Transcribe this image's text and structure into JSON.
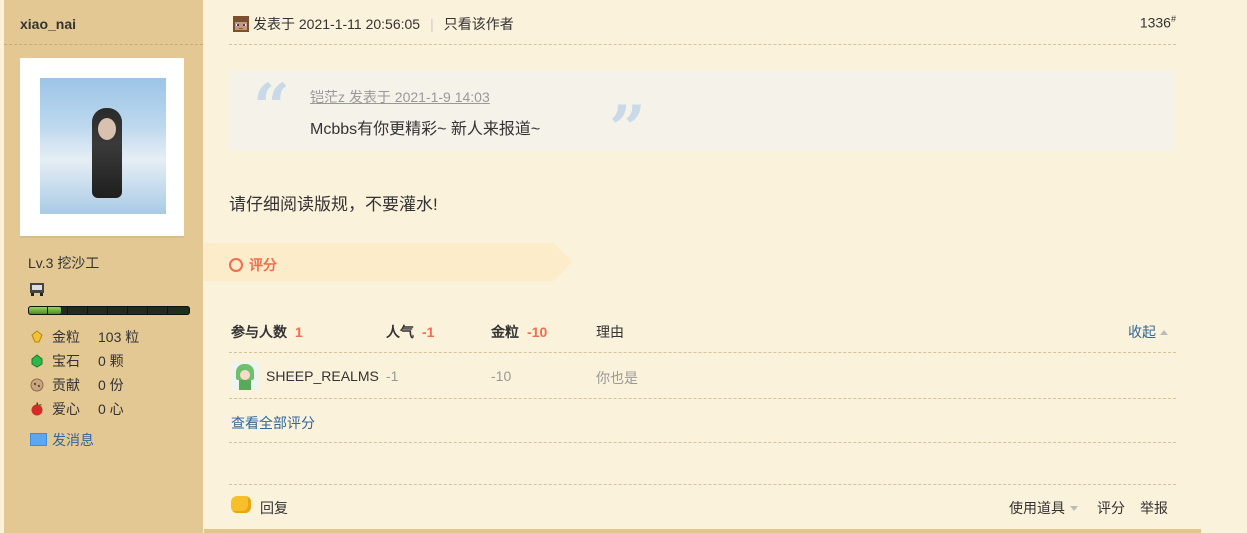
{
  "user": {
    "name": "xiao_nai",
    "level": "Lv.3 挖沙工",
    "level_progress": 0.2,
    "stats": [
      {
        "icon": "gold-nugget-icon",
        "label": "金粒",
        "value": "103 粒",
        "color": "#e8b21c"
      },
      {
        "icon": "emerald-icon",
        "label": "宝石",
        "value": "0 颗",
        "color": "#2fb84a"
      },
      {
        "icon": "contribution-icon",
        "label": "贡献",
        "value": "0 份",
        "color": "#a08060"
      },
      {
        "icon": "apple-heart-icon",
        "label": "爱心",
        "value": "0 心",
        "color": "#d42a2a"
      }
    ],
    "message_label": "发消息"
  },
  "post": {
    "posted_label": "发表于 2021-1-11 20:56:05",
    "author_only": "只看该作者",
    "floor_number": "1336",
    "floor_mark": "#",
    "quote": {
      "meta": "铠茫z 发表于 2021-1-9 14:03",
      "text": "Mcbbs有你更精彩~ 新人来报道~",
      "open_mark": "“",
      "close_mark": "”"
    },
    "body": "请仔细阅读版规，不要灌水!"
  },
  "rating": {
    "title": "评分",
    "headers": {
      "participants_label": "参与人数",
      "participants_value": "1",
      "popularity_label": "人气",
      "popularity_value": "-1",
      "gold_label": "金粒",
      "gold_value": "-10",
      "reason_label": "理由",
      "collapse_label": "收起"
    },
    "rows": [
      {
        "user": "SHEEP_REALMS",
        "popularity": "-1",
        "gold": "-10",
        "reason": "你也是"
      }
    ],
    "view_all": "查看全部评分"
  },
  "footer": {
    "reply": "回复",
    "tools": "使用道具",
    "score": "评分",
    "report": "举报"
  },
  "colors": {
    "sidebar_bg": "#e3c894",
    "main_bg": "#fbf2db",
    "accent_red": "#f26c4f",
    "link_blue": "#336699"
  }
}
